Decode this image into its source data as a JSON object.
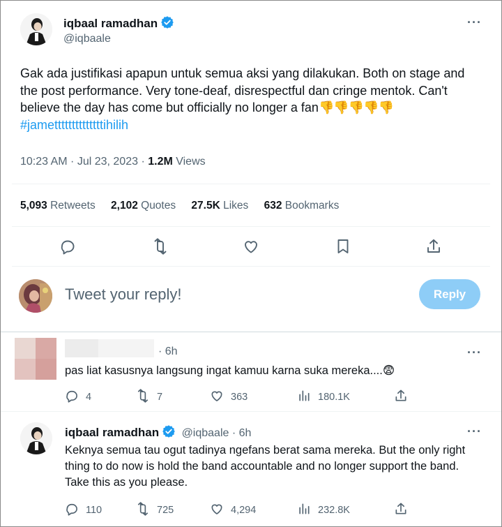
{
  "main_tweet": {
    "author_name": "iqbaal ramadhan",
    "author_handle": "@iqbaale",
    "text": "Gak ada justifikasi apapun untuk semua aksi yang dilakukan. Both on stage and the post performance. Very tone-deaf, disrespectful dan cringe mentok. Can't believe the day has come but officially no longer a fan",
    "emoji": "👎👎👎👎👎",
    "hashtag": "#jamettttttttttttttihilih",
    "time": "10:23 AM · Jul 23, 2023 · ",
    "views_count": "1.2M",
    "views_label": " Views",
    "stats": {
      "retweets_count": "5,093",
      "retweets_label": " Retweets",
      "quotes_count": "2,102",
      "quotes_label": " Quotes",
      "likes_count": "27.5K",
      "likes_label": " Likes",
      "bookmarks_count": "632",
      "bookmarks_label": " Bookmarks"
    },
    "more_label": "···"
  },
  "compose": {
    "placeholder": "Tweet your reply!",
    "reply_label": "Reply"
  },
  "reply_1": {
    "time": "· 6h",
    "text": "pas liat kasusnya langsung ingat kamuu karna suka mereka....",
    "emoji": "😨",
    "replies": "4",
    "retweets": "7",
    "likes": "363",
    "views": "180.1K",
    "more_label": "···"
  },
  "reply_2": {
    "author_name": "iqbaal ramadhan",
    "author_handle": "@iqbaale · 6h",
    "text": "Keknya semua tau ogut tadinya ngefans berat sama mereka. But the only right thing to do now is hold the band accountable and no longer support the band. Take this as you please.",
    "replies": "110",
    "retweets": "725",
    "likes": "4,294",
    "views": "232.8K",
    "more_label": "···"
  },
  "colors": {
    "accent": "#1d9bf0",
    "reply_button": "#8ecdf7",
    "muted_text": "#536471",
    "text": "#0f1419"
  },
  "icons": [
    "verified-badge-icon",
    "more-icon",
    "reply-icon",
    "retweet-icon",
    "like-icon",
    "bookmark-icon",
    "share-icon",
    "views-icon"
  ]
}
